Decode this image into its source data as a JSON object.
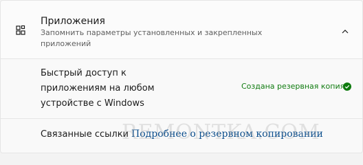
{
  "section": {
    "icon": "apps-grid-icon",
    "title": "Приложения",
    "description": "Запомнить параметры установленных и закрепленных приложений",
    "expand_icon": "chevron-up-icon"
  },
  "quick_access": {
    "text": "Быстрый доступ к приложениям на любом устройстве с Windows",
    "status": "Создана резервная копия",
    "status_icon": "check-circle-icon",
    "status_color": "#0f7b0f"
  },
  "related_links": {
    "label": "Связанные ссылки",
    "link_text": "Подробнее о резервном копировании"
  },
  "watermark": "REMONTKA.COM"
}
